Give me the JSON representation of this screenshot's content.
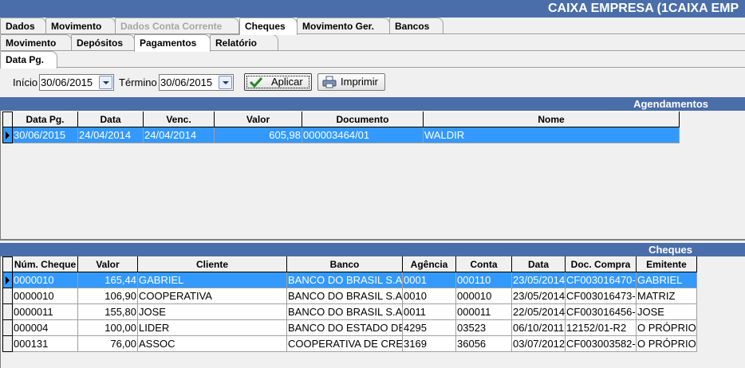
{
  "app": {
    "title": "CAIXA EMPRESA (1CAIXA EMP"
  },
  "tabs_main": [
    {
      "label": "Dados",
      "state": "normal"
    },
    {
      "label": "Movimento",
      "state": "normal"
    },
    {
      "label": "Dados Conta Corrente",
      "state": "disabled"
    },
    {
      "label": "Cheques",
      "state": "active"
    },
    {
      "label": "Movimento Ger.",
      "state": "normal"
    },
    {
      "label": "Bancos",
      "state": "normal"
    }
  ],
  "tabs_sub": [
    {
      "label": "Movimento",
      "state": "normal"
    },
    {
      "label": "Depósitos",
      "state": "normal"
    },
    {
      "label": "Pagamentos",
      "state": "active"
    },
    {
      "label": "Relatório",
      "state": "normal"
    }
  ],
  "tabs_third": [
    {
      "label": "Data Pg.",
      "state": "active"
    }
  ],
  "filter": {
    "inicio_label": "Início",
    "inicio_value": "30/06/2015",
    "termino_label": "Término",
    "termino_value": "30/06/2015",
    "apply_label": "Aplicar",
    "print_label": "Imprimir"
  },
  "agendamentos": {
    "title": "Agendamentos",
    "columns": [
      "Data Pg.",
      "Data",
      "Venc.",
      "Valor",
      "Documento",
      "Nome"
    ],
    "rows": [
      [
        "30/06/2015",
        "24/04/2014",
        "24/04/2014",
        "605,98",
        "000003464/01",
        "WALDIR"
      ]
    ]
  },
  "cheques": {
    "title": "Cheques",
    "columns": [
      "Núm. Cheque",
      "Valor",
      "Cliente",
      "Banco",
      "Agência",
      "Conta",
      "Data",
      "Doc. Compra",
      "Emitente"
    ],
    "rows": [
      [
        "0000010",
        "165,44",
        "GABRIEL",
        "BANCO DO BRASIL S.A",
        "0001",
        "000110",
        "23/05/2014",
        "CF003016470-(",
        "GABRIEL"
      ],
      [
        "0000010",
        "106,90",
        "COOPERATIVA",
        "BANCO DO BRASIL S.A",
        "0010",
        "000010",
        "23/05/2014",
        "CF003016473-(",
        "MATRIZ"
      ],
      [
        "0000011",
        "155,80",
        "JOSE",
        "BANCO DO BRASIL S.A",
        "0011",
        "000011",
        "22/05/2014",
        "CF003016456-(",
        "JOSE"
      ],
      [
        "000004",
        "100,00",
        "LIDER",
        "BANCO DO ESTADO DE",
        "4295",
        "03523",
        "06/10/2011",
        "12152/01-R2",
        "O PRÓPRIO"
      ],
      [
        "000131",
        "76,00",
        "ASSOC",
        "COOPERATIVA DE CRE",
        "3169",
        "36056",
        "03/07/2012",
        "CF003003582-(",
        "O PRÓPRIO"
      ]
    ]
  },
  "icons": {
    "apply": "checkmark-icon",
    "print": "printer-icon",
    "dropdown": "chevron-down-icon",
    "row_pointer": "row-pointer-icon"
  },
  "colors": {
    "header_blue": "#4a6ea9",
    "selection": "#3399ff"
  }
}
